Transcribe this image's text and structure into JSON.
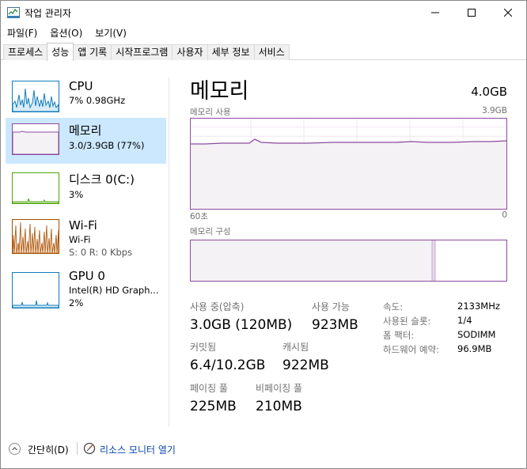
{
  "window": {
    "title": "작업 관리자"
  },
  "menu": [
    "파일(F)",
    "옵션(O)",
    "보기(V)"
  ],
  "tabs": [
    "프로세스",
    "성능",
    "앱 기록",
    "시작프로그램",
    "사용자",
    "세부 정보",
    "서비스"
  ],
  "active_tab_index": 1,
  "left": {
    "items": [
      {
        "title": "CPU",
        "sub1": "7% 0.98GHz",
        "sub2": ""
      },
      {
        "title": "메모리",
        "sub1": "3.0/3.9GB (77%)",
        "sub2": ""
      },
      {
        "title": "디스크 0(C:)",
        "sub1": "3%",
        "sub2": ""
      },
      {
        "title": "Wi-Fi",
        "sub1": "Wi-Fi",
        "sub2": "S: 0 R: 0 Kbps"
      },
      {
        "title": "GPU 0",
        "sub1": "Intel(R) HD Graph...",
        "sub2": "2%"
      }
    ],
    "selected_index": 1
  },
  "right": {
    "title": "메모리",
    "total": "4.0GB",
    "usage_label": "메모리 사용",
    "usage_max": "3.9GB",
    "time_left": "60초",
    "time_right": "0",
    "composition_label": "메모리 구성",
    "usage_level": 0.77,
    "stats": {
      "in_use_label": "사용 중(압축)",
      "in_use_value": "3.0GB (120MB)",
      "available_label": "사용 가능",
      "available_value": "923MB",
      "committed_label": "커밋됨",
      "committed_value": "6.4/10.2GB",
      "cached_label": "캐시됨",
      "cached_value": "922MB",
      "paged_label": "페이징 풀",
      "paged_value": "225MB",
      "nonpaged_label": "비페이징 풀",
      "nonpaged_value": "210MB"
    },
    "specs": [
      {
        "label": "속도:",
        "value": "2133MHz"
      },
      {
        "label": "사용된 슬롯:",
        "value": "1/4"
      },
      {
        "label": "폼 팩터:",
        "value": "SODIMM"
      },
      {
        "label": "하드웨어 예약:",
        "value": "96.9MB"
      }
    ]
  },
  "bottom": {
    "simple": "간단히(D)",
    "resource_monitor": "리소스 모니터 열기"
  },
  "colors": {
    "memory": "#8b4ba0",
    "cpu": "#117dbb",
    "disk": "#4da60c",
    "wifi": "#a74f01",
    "selected": "#cce8ff"
  }
}
